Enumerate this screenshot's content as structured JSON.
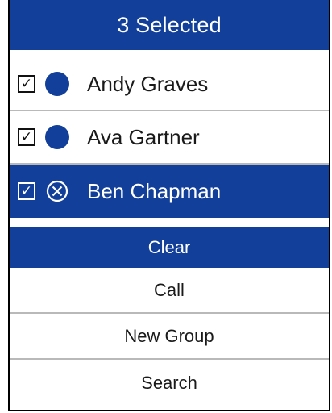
{
  "header": {
    "title": "3 Selected"
  },
  "contacts": [
    {
      "name": "Andy Graves",
      "checked": true,
      "icon": "avatar-dot"
    },
    {
      "name": "Ava Gartner",
      "checked": true,
      "icon": "avatar-dot"
    },
    {
      "name": "Ben Chapman",
      "checked": true,
      "icon": "deselect-x-icon"
    }
  ],
  "checkmark": "✓",
  "actions": {
    "clear": "Clear",
    "call": "Call",
    "new_group": "New Group",
    "search": "Search"
  },
  "colors": {
    "accent": "#123f99",
    "divider": "#b9b9b9",
    "text": "#1a1a1a"
  }
}
